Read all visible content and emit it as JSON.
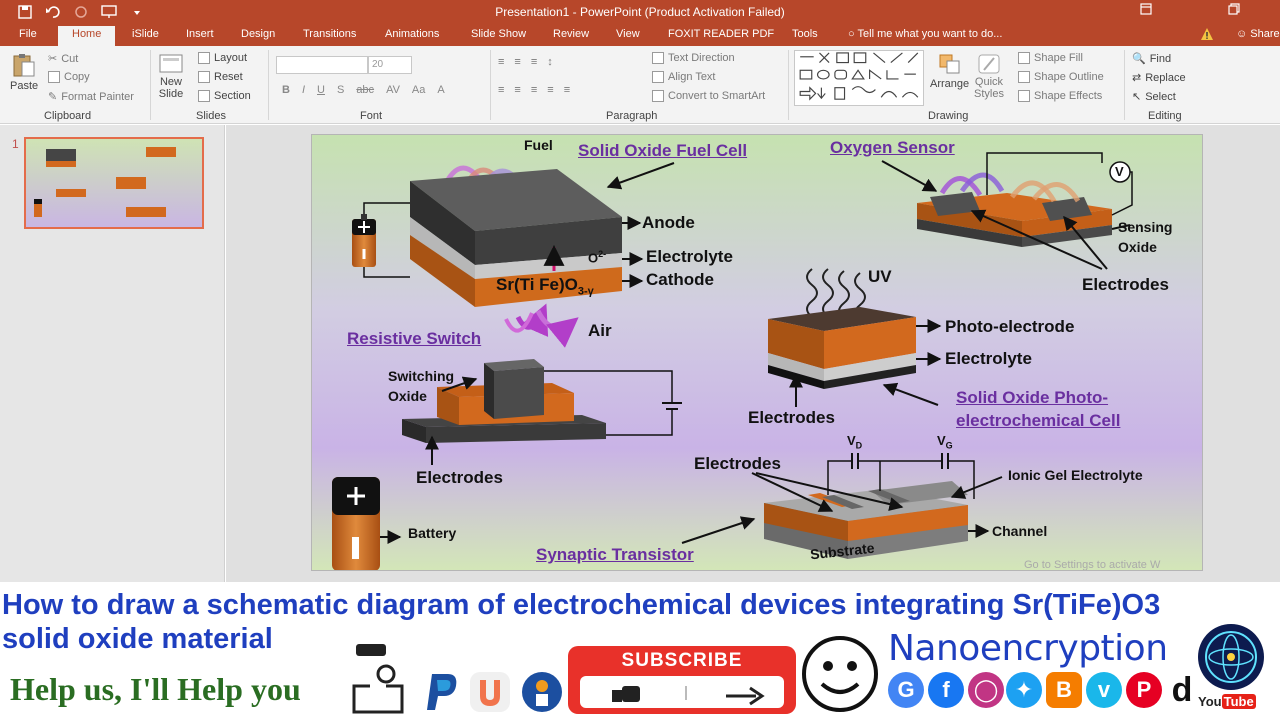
{
  "window": {
    "title": "Presentation1 - PowerPoint (Product Activation Failed)"
  },
  "tabs": [
    {
      "label": "File"
    },
    {
      "label": "Home"
    },
    {
      "label": "iSlide"
    },
    {
      "label": "Insert"
    },
    {
      "label": "Design"
    },
    {
      "label": "Transitions"
    },
    {
      "label": "Animations"
    },
    {
      "label": "Slide Show"
    },
    {
      "label": "Review"
    },
    {
      "label": "View"
    },
    {
      "label": "FOXIT READER PDF"
    },
    {
      "label": "Tools"
    }
  ],
  "tell_me": "Tell me what you want to do...",
  "share": "Share",
  "ribbon": {
    "clipboard": {
      "paste": "Paste",
      "cut": "Cut",
      "copy": "Copy",
      "format_painter": "Format Painter",
      "group": "Clipboard"
    },
    "slides": {
      "new_slide": "New",
      "new_slide2": "Slide",
      "layout": "Layout",
      "reset": "Reset",
      "section": "Section",
      "group": "Slides"
    },
    "font": {
      "size": "20",
      "group": "Font"
    },
    "paragraph": {
      "text_direction": "Text Direction",
      "align_text": "Align Text",
      "convert": "Convert to SmartArt",
      "group": "Paragraph"
    },
    "drawing": {
      "arrange": "Arrange",
      "quick_styles": "Quick",
      "quick_styles2": "Styles",
      "shape_fill": "Shape Fill",
      "shape_outline": "Shape Outline",
      "shape_effects": "Shape Effects",
      "group": "Drawing"
    },
    "editing": {
      "find": "Find",
      "replace": "Replace",
      "select": "Select",
      "group": "Editing"
    }
  },
  "slide_panel": {
    "number": "1"
  },
  "slide": {
    "fuel_cell": {
      "fuel": "Fuel",
      "title": "Solid Oxide Fuel Cell",
      "anode": "Anode",
      "o2": "O",
      "o2_sup": "2-",
      "electrolyte": "Electrolyte",
      "formula": "Sr(Ti Fe)O",
      "formula_sub": "3-γ",
      "cathode": "Cathode",
      "air": "Air"
    },
    "oxygen_sensor": {
      "title": "Oxygen Sensor",
      "v": "V",
      "sensing": "Sensing",
      "oxide": "Oxide",
      "electrodes": "Electrodes"
    },
    "photo_cell": {
      "uv": "UV",
      "photo_electrode": "Photo-electrode",
      "electrolyte": "Electrolyte",
      "electrodes": "Electrodes",
      "title1": "Solid Oxide Photo-",
      "title2": "electrochemical Cell"
    },
    "resistive_switch": {
      "title": "Resistive Switch",
      "switching": "Switching",
      "oxide": "Oxide",
      "electrodes": "Electrodes"
    },
    "battery": {
      "label": "Battery"
    },
    "synaptic": {
      "vd": "V",
      "vd_sub": "D",
      "vg": "V",
      "vg_sub": "G",
      "electrodes": "Electrodes",
      "gel": "Ionic Gel Electrolyte",
      "channel": "Channel",
      "substrate": "Substrate",
      "title": "Synaptic Transistor"
    },
    "watermark": "Go to Settings to activate W"
  },
  "overlay": {
    "headline1": "How to draw a schematic diagram of electrochemical devices integrating Sr(TiFe)O3",
    "headline2": "solid oxide material",
    "help": "Help us, I'll Help you",
    "subscribe": "SUBSCRIBE",
    "brand": "Nanoencryption",
    "youtube_you": "You",
    "youtube_tube": "Tube"
  },
  "colors": {
    "ribbon_red": "#b7472a",
    "orange": "#d2691e",
    "dark_gray": "#454545",
    "purple_label": "#6a2fa0",
    "headline_blue": "#1f3fbf"
  }
}
